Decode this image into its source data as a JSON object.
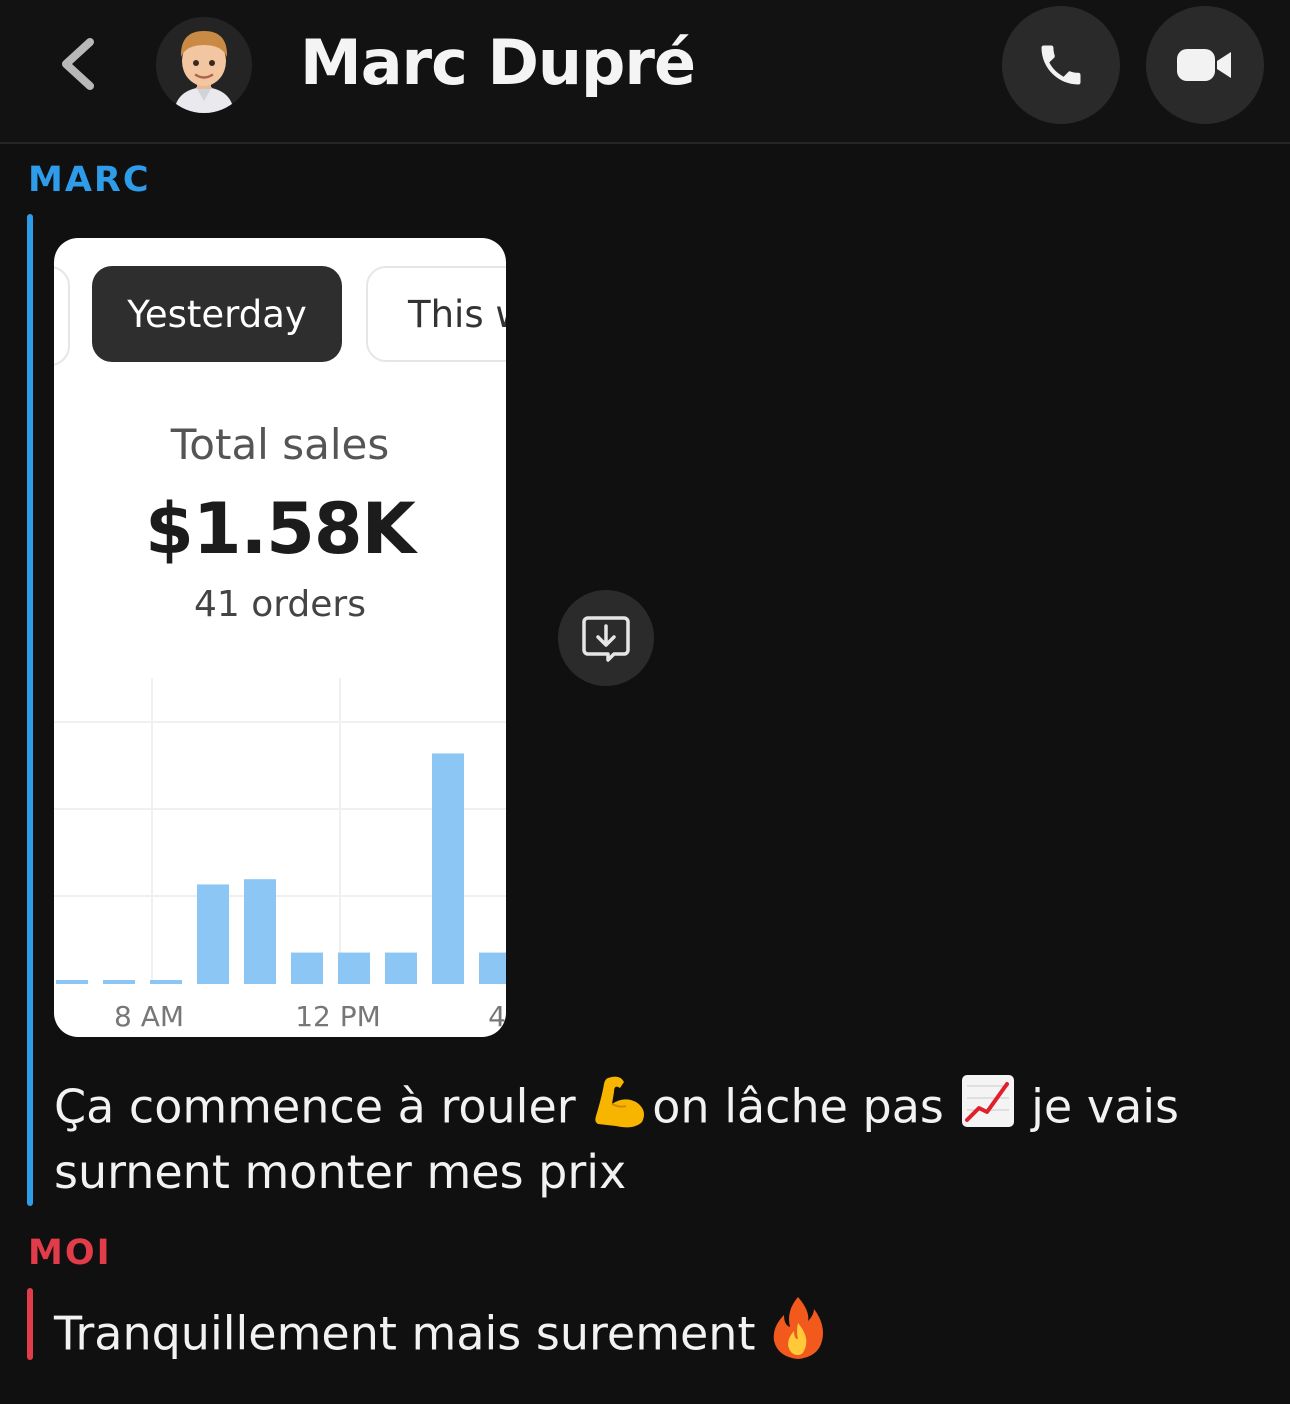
{
  "header": {
    "title": "Marc Dupré",
    "back_icon": "chevron-left-icon",
    "call_icon": "phone-icon",
    "video_icon": "video-camera-icon"
  },
  "conversation": {
    "marc": {
      "sender": "MARC",
      "accent": "#2e9ce8",
      "image": {
        "tabs": [
          "Yesterday",
          "This w"
        ],
        "selected_tab": "Yesterday",
        "total_sales_label": "Total sales",
        "total_sales_value": "$1.58K",
        "orders": "41 orders"
      },
      "message_line1": "Ça commence à rouler",
      "message_mid": "on lâche pas",
      "message_end": "je vais",
      "message_line2": "surnent monter mes prix"
    },
    "moi": {
      "sender": "MOI",
      "accent": "#e23c4a",
      "message": "Tranquillement mais surement"
    }
  },
  "chart_data": {
    "type": "bar",
    "color": "#8cc6f4",
    "tick_labels": [
      "8 AM",
      "12 PM",
      "4"
    ],
    "values": [
      1,
      1,
      1,
      38,
      40,
      12,
      12,
      12,
      88,
      12
    ],
    "ylim": [
      0,
      100
    ],
    "grid": true
  }
}
